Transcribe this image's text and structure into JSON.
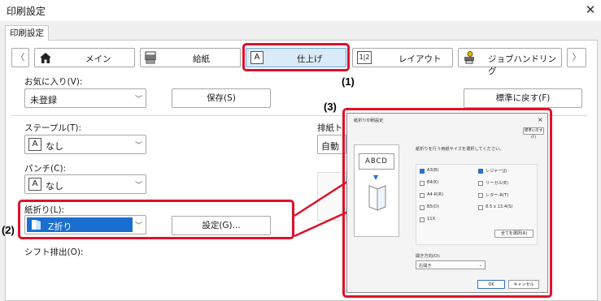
{
  "window": {
    "title": "印刷設定",
    "close_glyph": "✕"
  },
  "tab": {
    "label": "印刷設定"
  },
  "nav": {
    "prev_glyph": "〈",
    "next_glyph": "〉",
    "tabs": [
      {
        "label": "メイン",
        "icon": "home-icon"
      },
      {
        "label": "給紙",
        "icon": "printer-tray-icon"
      },
      {
        "label": "仕上げ",
        "icon": "finishing-icon",
        "icon_glyph": "A"
      },
      {
        "label": "レイアウト",
        "icon": "layout-icon",
        "icon_glyph": "1|2"
      },
      {
        "label": "ジョブハンドリング",
        "icon": "job-handling-icon"
      }
    ]
  },
  "favorites": {
    "label": "お気に入り(V):",
    "value": "未登録",
    "save_label": "保存(S)",
    "reset_label": "標準に戻す(F)"
  },
  "staple": {
    "label": "ステープル(T):",
    "value": "なし",
    "icon_glyph": "A"
  },
  "punch": {
    "label": "パンチ(C):",
    "value": "なし",
    "icon_glyph": "A"
  },
  "fold": {
    "label": "紙折り(L):",
    "value": "Z折り",
    "settings_label": "設定(G)..."
  },
  "shift": {
    "label": "シフト排出(O):"
  },
  "output": {
    "label": "排紙ト",
    "value": "自動"
  },
  "annotations": {
    "one": "(1)",
    "two": "(2)",
    "three": "(3)"
  },
  "dialog": {
    "title": "紙折り印刷設定",
    "close_glyph": "×",
    "reset_label": "標準に戻す(F)",
    "preview_text": "ABCD",
    "description": "紙折りを行う用紙サイズを選択してください。",
    "sizes_left": [
      {
        "label": "A3(B)",
        "checked": true
      },
      {
        "label": "B4(K)",
        "checked": false
      },
      {
        "label": "A4-R(R)",
        "checked": false
      },
      {
        "label": "B5(D)",
        "checked": false
      },
      {
        "label": "11X",
        "checked": false
      }
    ],
    "sizes_right": [
      {
        "label": "レジャー(J)",
        "checked": true
      },
      {
        "label": "リーガル(E)",
        "checked": false
      },
      {
        "label": "レター-R(T)",
        "checked": false
      },
      {
        "label": "8.5 x 13.4(S)",
        "checked": false
      }
    ],
    "select_all_label": "全てを選択(A)",
    "direction_label": "開き方向(O):",
    "direction_value": "右開き",
    "ok_label": "OK",
    "cancel_label": "キャンセル"
  },
  "colors": {
    "accent_red": "#e0102a",
    "selected_blue": "#1a6fd1"
  }
}
